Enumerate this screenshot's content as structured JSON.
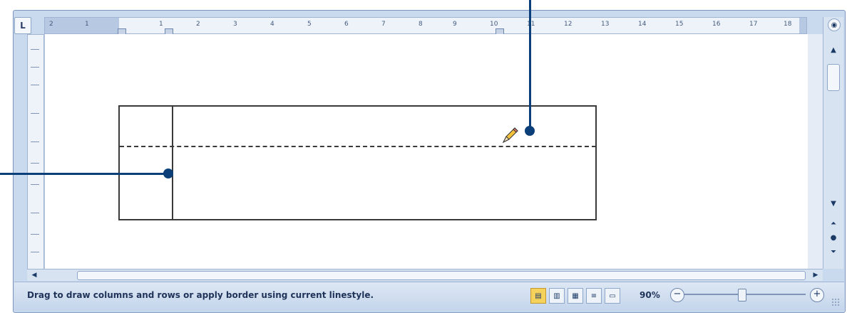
{
  "ruler": {
    "tab_selector": "L",
    "ticks": [
      "2",
      "1",
      "1",
      "2",
      "3",
      "4",
      "5",
      "6",
      "7",
      "8",
      "9",
      "10",
      "11",
      "12",
      "13",
      "14",
      "15",
      "16",
      "17",
      "18"
    ]
  },
  "status": {
    "message": "Drag to draw columns and rows or apply border using current linestyle."
  },
  "zoom": {
    "level": "90%",
    "minus": "−",
    "plus": "+"
  },
  "icons": {
    "pencil": "pencil-icon",
    "prev_page": "double-up-arrow-icon",
    "next_page": "double-down-arrow-icon",
    "select_browse": "circle-icon"
  },
  "colors": {
    "callout": "#0a3f7a",
    "active_view": "#f5d25c"
  }
}
